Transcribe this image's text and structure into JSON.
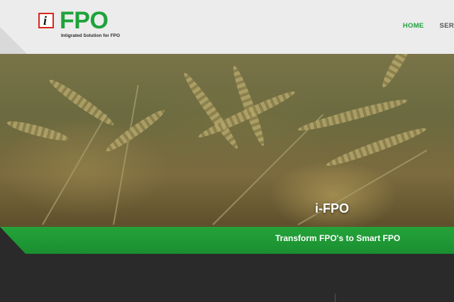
{
  "logo": {
    "icon_letter": "i",
    "name": "FPO",
    "tagline": "Intigrated Solution for FPO"
  },
  "nav": {
    "items": [
      {
        "label": "HOME",
        "active": true
      },
      {
        "label": "SER"
      }
    ]
  },
  "hero": {
    "title": "i-FPO",
    "subtitle": "Transform FPO's to Smart FPO"
  },
  "colors": {
    "brand_green": "#1ea33a",
    "logo_red": "#d9261c",
    "dark": "#2a2a2a"
  }
}
